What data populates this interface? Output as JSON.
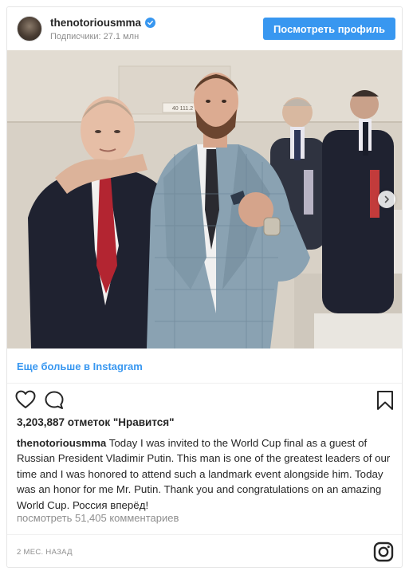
{
  "header": {
    "username": "thenotoriousmma",
    "subscribers": "Подписчики: 27.1 млн",
    "view_profile_label": "Посмотреть профиль"
  },
  "photo": {
    "tag_text": "40 111.2"
  },
  "more_link": "Еще больше в Instagram",
  "likes": "3,203,887 отметок \"Нравится\"",
  "caption": {
    "username": "thenotoriousmma",
    "text": "Today I was invited to the World Cup final as a guest of Russian President Vladimir Putin. This man is one of the greatest leaders of our time and I was honored to attend such a landmark event alongside him. Today was an honor for me Mr. Putin. Thank you and congratulations on an amazing World Cup. Россия вперёд!"
  },
  "comments_link": "посмотреть 51,405 комментариев",
  "timestamp": "2 МЕС. НАЗАД",
  "icons": {
    "verified": "verified-badge-icon",
    "heart": "heart-icon",
    "comment": "comment-icon",
    "save": "bookmark-icon",
    "instagram": "instagram-logo-icon",
    "next": "chevron-right-icon"
  },
  "colors": {
    "accent": "#3897f0",
    "text": "#262626",
    "muted": "#8e8e8e",
    "border": "#e6e6e6"
  }
}
